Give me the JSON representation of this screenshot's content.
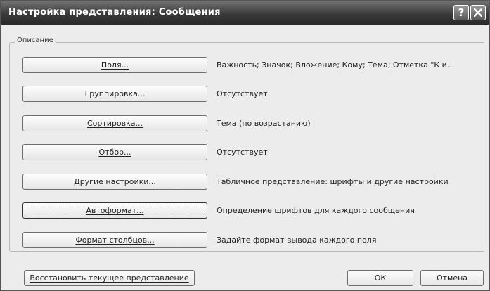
{
  "window": {
    "title": "Настройка представления: Сообщения",
    "help_glyph": "?",
    "close_icon": "close-icon"
  },
  "group": {
    "label": "Описание"
  },
  "rows": [
    {
      "button": "Поля...",
      "description": "Важность; Значок; Вложение; Кому; Тема; Отметка \"К и..."
    },
    {
      "button": "Группировка...",
      "description": "Отсутствует"
    },
    {
      "button": "Сортировка...",
      "description": "Тема (по возрастанию)"
    },
    {
      "button": "Отбор...",
      "description": "Отсутствует"
    },
    {
      "button": "Другие настройки...",
      "description": "Табличное представление: шрифты и другие настройки"
    },
    {
      "button": "Автоформат...",
      "description": "Определение шрифтов для каждого сообщения"
    },
    {
      "button": "Формат столбцов...",
      "description": "Задайте формат вывода каждого поля"
    }
  ],
  "footer": {
    "restore_label": "Восстановить текущее представление",
    "ok_label": "ОК",
    "cancel_label": "Отмена"
  }
}
